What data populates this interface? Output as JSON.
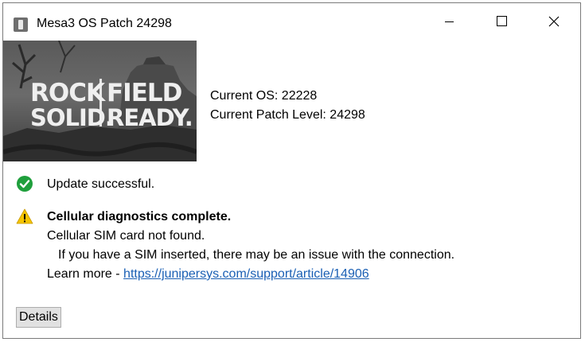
{
  "window": {
    "title": "Mesa3 OS Patch 24298"
  },
  "banner": {
    "line1_left": "ROCK",
    "line1_right": "FIELD",
    "line2_left": "SOLID.",
    "line2_right": "READY."
  },
  "os_info": {
    "current_os": "Current OS: 22228",
    "current_patch_level": "Current Patch Level: 24298"
  },
  "status": {
    "success_message": "Update successful.",
    "warning_title": "Cellular diagnostics complete.",
    "warning_line1": "Cellular SIM card not found.",
    "warning_line2": "If you have a SIM inserted, there may be an issue with the connection.",
    "learn_more_label": "Learn more - ",
    "learn_more_link": "https://junipersys.com/support/article/14906"
  },
  "buttons": {
    "details_label": "Details"
  },
  "icons": {
    "app": "app-icon",
    "minimize": "minimize-icon",
    "maximize": "maximize-icon",
    "close": "close-icon",
    "success": "check-circle-icon",
    "warning": "warning-triangle-icon"
  },
  "colors": {
    "success_green": "#1f9f3c",
    "warning_yellow": "#f5c400",
    "link_blue": "#1a5fb4",
    "button_face": "#e1e1e1"
  }
}
